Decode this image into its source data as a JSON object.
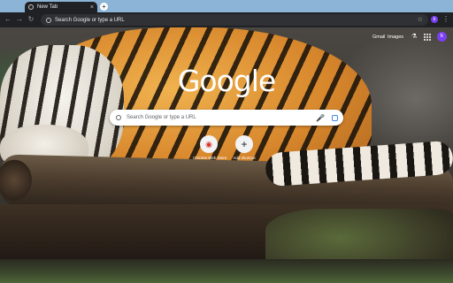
{
  "browser": {
    "tab_title": "New Tab",
    "tab_close_glyph": "×",
    "new_tab_glyph": "+",
    "back_glyph": "←",
    "forward_glyph": "→",
    "reload_glyph": "↻",
    "omnibox_placeholder": "Search Google or type a URL",
    "star_glyph": "☆",
    "profile_initial": "k",
    "menu_glyph": "⋮"
  },
  "ntp": {
    "top_links": [
      "Gmail",
      "Images"
    ],
    "labs_glyph": "⚗",
    "avatar_initial": "k",
    "logo_text": "Google",
    "search_placeholder": "Search Google or type a URL",
    "mic_glyph": "🎤",
    "shortcuts": [
      {
        "label": "Chrome Web Store",
        "icon": "chrome-web-store-icon",
        "glyph": "◉"
      },
      {
        "label": "Add shortcut",
        "icon": "plus-icon",
        "glyph": "+"
      }
    ]
  },
  "colors": {
    "tabstrip": "#8cb4d6",
    "toolbar": "#202124",
    "profile": "#7b3ff2"
  }
}
